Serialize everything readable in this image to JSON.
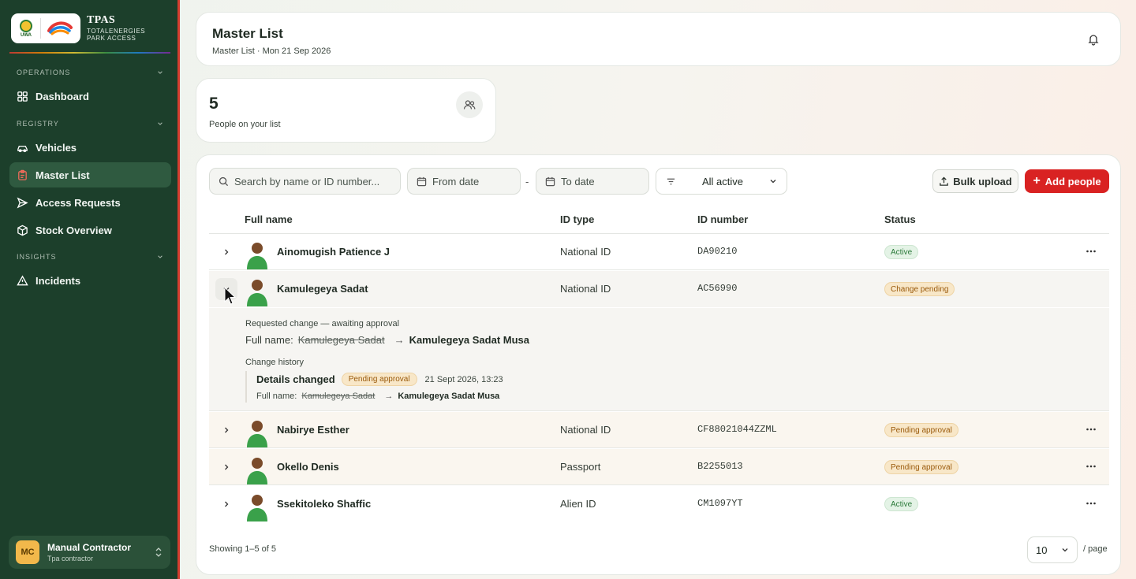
{
  "brand": {
    "title": "TPAS",
    "subtitle_line1": "TOTALENERGIES",
    "subtitle_line2": "PARK ACCESS",
    "uwa_logo_text": "UWA",
    "logo_total": "totalenergies-logo",
    "logo_uwa": "uwa-seal-logo"
  },
  "sidebar": {
    "groups": {
      "operations": "OPERATIONS",
      "registry": "REGISTRY",
      "insights": "INSIGHTS"
    },
    "items": [
      {
        "label": "Dashboard",
        "icon": "grid-icon"
      },
      {
        "label": "Vehicles",
        "icon": "car-icon"
      },
      {
        "label": "Master List",
        "icon": "clipboard-icon",
        "active": true
      },
      {
        "label": "Access Requests",
        "icon": "send-icon"
      },
      {
        "label": "Stock Overview",
        "icon": "box-icon"
      },
      {
        "label": "Incidents",
        "icon": "warning-icon"
      }
    ],
    "user": {
      "initials": "MC",
      "name": "Manual Contractor",
      "role": "Tpa contractor"
    }
  },
  "header": {
    "title": "Master List",
    "subtitle": "Master List · Mon 21 Sep 2026"
  },
  "stat": {
    "count": "5",
    "label": "People on your list"
  },
  "toolbar": {
    "search_placeholder": "Search by name or ID number...",
    "from_date": "From date",
    "to_date": "To date",
    "dash": "-",
    "filter_value": "All active",
    "bulk_upload": "Bulk upload",
    "add_people": "Add people"
  },
  "table": {
    "columns": [
      "Full name",
      "ID type",
      "ID number",
      "Status"
    ],
    "rows": [
      {
        "name": "Ainomugish Patience J",
        "id_type": "National ID",
        "id_number": "DA90210",
        "status": "Active"
      },
      {
        "name": "Kamulegeya Sadat",
        "id_type": "National ID",
        "id_number": "AC56990",
        "status": "Change pending"
      },
      {
        "name": "Nabirye Esther",
        "id_type": "National ID",
        "id_number": "CF88021044ZZML",
        "status": "Pending approval"
      },
      {
        "name": "Okello Denis",
        "id_type": "Passport",
        "id_number": "B2255013",
        "status": "Pending approval"
      },
      {
        "name": "Ssekitoleko Shaffic",
        "id_type": "Alien ID",
        "id_number": "CM1097YT",
        "status": "Active"
      }
    ]
  },
  "detail": {
    "requested_title": "Requested change — awaiting approval",
    "field_label": "Full name:",
    "old_value": "Kamulegeya Sadat",
    "arrow": "→",
    "new_value": "Kamulegeya Sadat Musa",
    "history_title": "Change history",
    "history_event": "Details changed",
    "history_badge": "Pending approval",
    "history_date": "21 Sept 2026, 13:23",
    "history_field_label": "Full name:",
    "history_old": "Kamulegeya Sadat",
    "history_new": "Kamulegeya Sadat Musa"
  },
  "footer": {
    "showing": "Showing 1–5 of 5",
    "page_size": "10",
    "per_page": "/ page"
  },
  "colors": {
    "sidebar_bg": "#1c3f2b",
    "accent_red": "#d92222",
    "active_badge": "#e4f3e6",
    "pending_badge": "#f8e7c8"
  }
}
